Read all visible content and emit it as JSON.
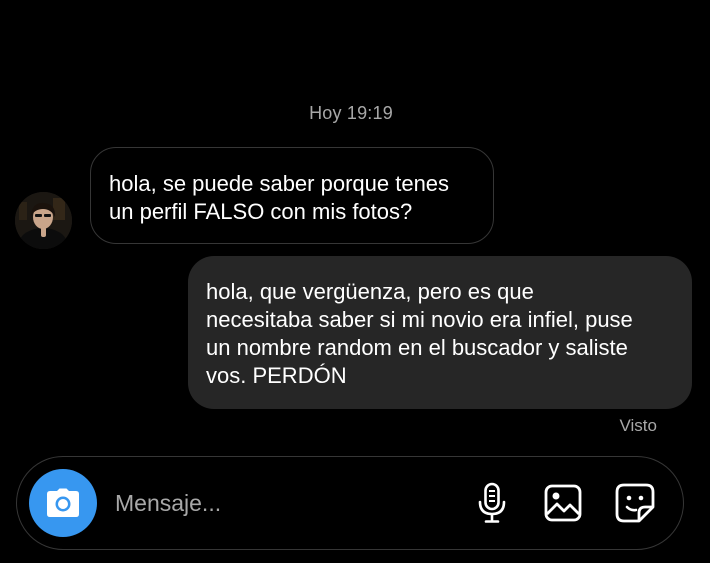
{
  "thread": {
    "timestamp": "Hoy 19:19",
    "messages": [
      {
        "direction": "received",
        "lines": [
          "hola, se puede saber porque tenes",
          "un perfil FALSO con mis fotos?"
        ]
      },
      {
        "direction": "sent",
        "lines": [
          "hola, que vergüenza, pero es que",
          "necesitaba saber si mi novio era infiel, puse",
          "un nombre random en el buscador y saliste",
          "vos. PERDÓN"
        ]
      }
    ],
    "seen_label": "Visto"
  },
  "composer": {
    "placeholder": "Mensaje...",
    "value": "",
    "icons": [
      "camera-icon",
      "microphone-icon",
      "gallery-icon",
      "sticker-icon"
    ]
  },
  "colors": {
    "background": "#000000",
    "sent_bubble": "#262626",
    "received_border": "#363636",
    "accent": "#3797f0",
    "muted_text": "#a8a8a8"
  }
}
